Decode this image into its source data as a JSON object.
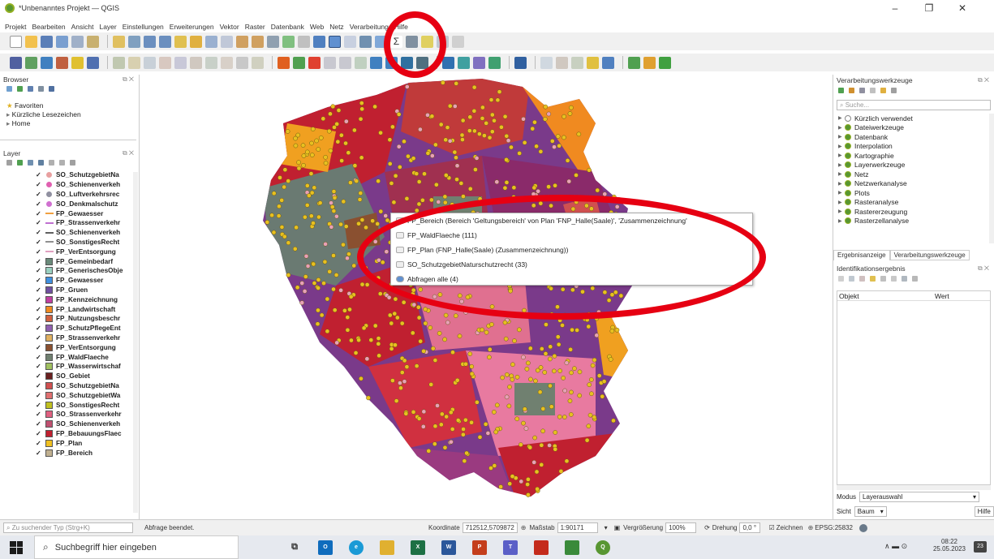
{
  "window": {
    "title": "*Unbenanntes Projekt — QGIS",
    "minimize": "–",
    "maximize": "❐",
    "close": "✕"
  },
  "menu": [
    "Projekt",
    "Bearbeiten",
    "Ansicht",
    "Layer",
    "Einstellungen",
    "Erweiterungen",
    "Vektor",
    "Raster",
    "Datenbank",
    "Web",
    "Netz",
    "Verarbeitung",
    "Hilfe"
  ],
  "browser": {
    "title": "Browser",
    "items": [
      "Favoriten",
      "Kürzliche Lesezeichen",
      "Home"
    ]
  },
  "layers": {
    "title": "Layer",
    "items": [
      {
        "name": "SO_SchutzgebietNa",
        "kind": "point",
        "color": "#e8a0a0"
      },
      {
        "name": "SO_Schienenverkeh",
        "kind": "point",
        "color": "#e060b0"
      },
      {
        "name": "SO_Luftverkehrsrec",
        "kind": "point",
        "color": "#9090a0"
      },
      {
        "name": "SO_Denkmalschutz",
        "kind": "point",
        "color": "#d070d0"
      },
      {
        "name": "FP_Gewaesser",
        "kind": "line",
        "color": "#f0a040"
      },
      {
        "name": "FP_Strassenverkehr",
        "kind": "line",
        "color": "#c070d0"
      },
      {
        "name": "SO_Schienenverkeh",
        "kind": "line",
        "color": "#606060"
      },
      {
        "name": "SO_SonstigesRecht",
        "kind": "line",
        "color": "#909090"
      },
      {
        "name": "FP_VerEntsorgung",
        "kind": "line",
        "color": "#e0a0c0"
      },
      {
        "name": "FP_Gemeinbedarf",
        "kind": "poly",
        "color": "#6a8a7a"
      },
      {
        "name": "FP_GenerischesObje",
        "kind": "poly",
        "color": "#9ad0c0"
      },
      {
        "name": "FP_Gewaesser",
        "kind": "poly",
        "color": "#4090e0"
      },
      {
        "name": "FP_Gruen",
        "kind": "poly",
        "color": "#7050a0"
      },
      {
        "name": "FP_Kennzeichnung",
        "kind": "poly",
        "color": "#c040a0"
      },
      {
        "name": "FP_Landwirtschaft",
        "kind": "poly",
        "color": "#f08a20"
      },
      {
        "name": "FP_Nutzungsbeschr",
        "kind": "poly",
        "color": "#d06040"
      },
      {
        "name": "FP_SchutzPflegeEnt",
        "kind": "poly",
        "color": "#9060b0"
      },
      {
        "name": "FP_Strassenverkehr",
        "kind": "poly",
        "color": "#e0b060"
      },
      {
        "name": "FP_VerEntsorgung",
        "kind": "poly",
        "color": "#8a5030"
      },
      {
        "name": "FP_WaldFlaeche",
        "kind": "poly",
        "color": "#708070"
      },
      {
        "name": "FP_Wasserwirtschaf",
        "kind": "poly",
        "color": "#a0c060"
      },
      {
        "name": "SO_Gebiet",
        "kind": "poly",
        "color": "#6a2020"
      },
      {
        "name": "SO_SchutzgebietNa",
        "kind": "poly",
        "color": "#d05050"
      },
      {
        "name": "SO_SchutzgebietWa",
        "kind": "poly",
        "color": "#e07070"
      },
      {
        "name": "SO_SonstigesRecht",
        "kind": "poly",
        "color": "#c0c020"
      },
      {
        "name": "SO_Strassenverkehr",
        "kind": "poly",
        "color": "#e06080"
      },
      {
        "name": "SO_Schienenverkeh",
        "kind": "poly",
        "color": "#c05070"
      },
      {
        "name": "FP_BebauungsFlaec",
        "kind": "poly",
        "color": "#c02030"
      },
      {
        "name": "FP_Plan",
        "kind": "poly",
        "color": "#f0c020"
      },
      {
        "name": "FP_Bereich",
        "kind": "poly",
        "color": "#c0b090"
      }
    ]
  },
  "context_menu": {
    "items": [
      "FP_Bereich (Bereich 'Geltungsbereich' von Plan 'FNP_Halle(Saale)', 'Zusammenzeichnung'",
      "FP_WaldFlaeche (111)",
      "FP_Plan (FNP_Halle(Saale) (Zusammenzeichnung))",
      "SO_SchutzgebietNaturschutzrecht (33)",
      "Abfragen alle (4)"
    ]
  },
  "processing": {
    "title": "Verarbeitungswerkzeuge",
    "search_placeholder": "Suche...",
    "items": [
      "Kürzlich verwendet",
      "Dateiwerkzeuge",
      "Datenbank",
      "Interpolation",
      "Kartographie",
      "Layerwerkzeuge",
      "Netz",
      "Netzwerkanalyse",
      "Plots",
      "Rasteranalyse",
      "Rastererzeugung",
      "Rasterzellanalyse"
    ],
    "tabs": [
      "Ergebnisanzeige",
      "Verarbeitungswerkzeuge"
    ]
  },
  "identify": {
    "title": "Identifikationsergebnis",
    "col_object": "Objekt",
    "col_value": "Wert",
    "mode_label": "Modus",
    "mode_value": "Layerauswahl",
    "view_label": "Sicht",
    "view_value": "Baum",
    "help": "Hilfe"
  },
  "status": {
    "locator_placeholder": "Zu suchender Typ (Strg+K)",
    "message": "Abfrage beendet.",
    "coord_label": "Koordinate",
    "coord_value": "712512,5709872",
    "scale_label": "Maßstab",
    "scale_value": "1:90171",
    "magnifier_label": "Vergrößerung",
    "magnifier_value": "100%",
    "rotation_label": "Drehung",
    "rotation_value": "0,0 °",
    "render_label": "Zeichnen",
    "crs": "EPSG:25832"
  },
  "taskbar": {
    "search_placeholder": "Suchbegriff hier eingeben",
    "time": "08:22",
    "date": "25.05.2023",
    "notif_count": "23"
  }
}
